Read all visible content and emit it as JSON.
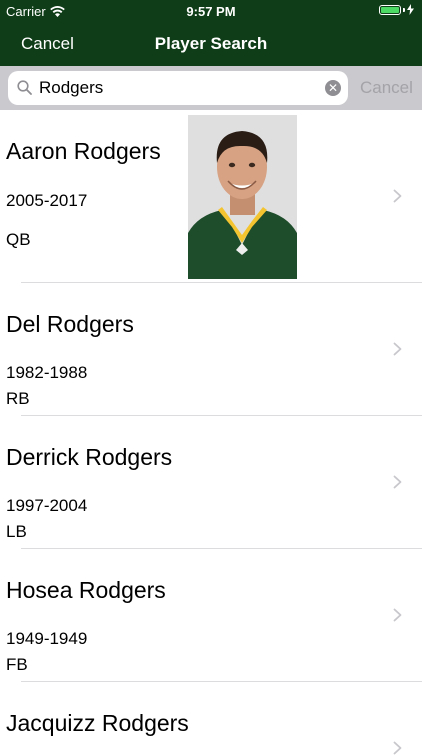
{
  "status_bar": {
    "carrier": "Carrier",
    "time": "9:57 PM",
    "icons": [
      "wifi-icon",
      "battery-icon",
      "charging-bolt-icon"
    ]
  },
  "nav": {
    "cancel_label": "Cancel",
    "title": "Player Search"
  },
  "search": {
    "value": "Rodgers",
    "cancel_label": "Cancel",
    "icons": [
      "search-icon",
      "clear-icon"
    ]
  },
  "results": [
    {
      "name": "Aaron Rodgers",
      "years": "2005-2017",
      "position": "QB",
      "has_photo": true
    },
    {
      "name": "Del Rodgers",
      "years": "1982-1988",
      "position": "RB"
    },
    {
      "name": "Derrick Rodgers",
      "years": "1997-2004",
      "position": "LB"
    },
    {
      "name": "Hosea Rodgers",
      "years": "1949-1949",
      "position": "FB"
    },
    {
      "name": "Jacquizz Rodgers"
    }
  ],
  "colors": {
    "nav_background": "#0f3d17",
    "search_bar_background": "#c9c9ce",
    "separator": "#dcdcdf",
    "chevron": "#c7c7cc"
  }
}
